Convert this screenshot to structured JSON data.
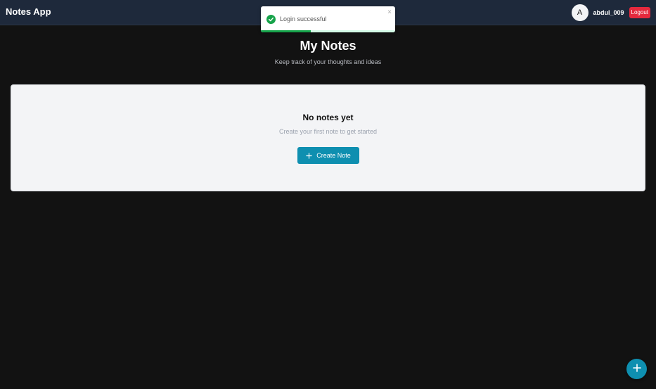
{
  "app": {
    "title": "Notes App"
  },
  "user": {
    "avatar_initial": "A",
    "username": "abdul_009",
    "logout_label": "Logout"
  },
  "toast": {
    "message": "Login successful",
    "close_glyph": "×",
    "progress_fraction": 0.37,
    "status_color": "#16a34a"
  },
  "main": {
    "title": "My Notes",
    "subtitle": "Keep track of your thoughts and ideas",
    "empty_state": {
      "title": "No notes yet",
      "description": "Create your first note to get started",
      "create_button_label": "Create Note"
    }
  },
  "colors": {
    "navbar": "#1e293b",
    "accent": "#0e8fb0",
    "danger": "#e5293d",
    "background": "#121212"
  },
  "icons": {
    "toast": "check-circle-icon",
    "create": "plus-icon",
    "fab": "plus-icon"
  }
}
